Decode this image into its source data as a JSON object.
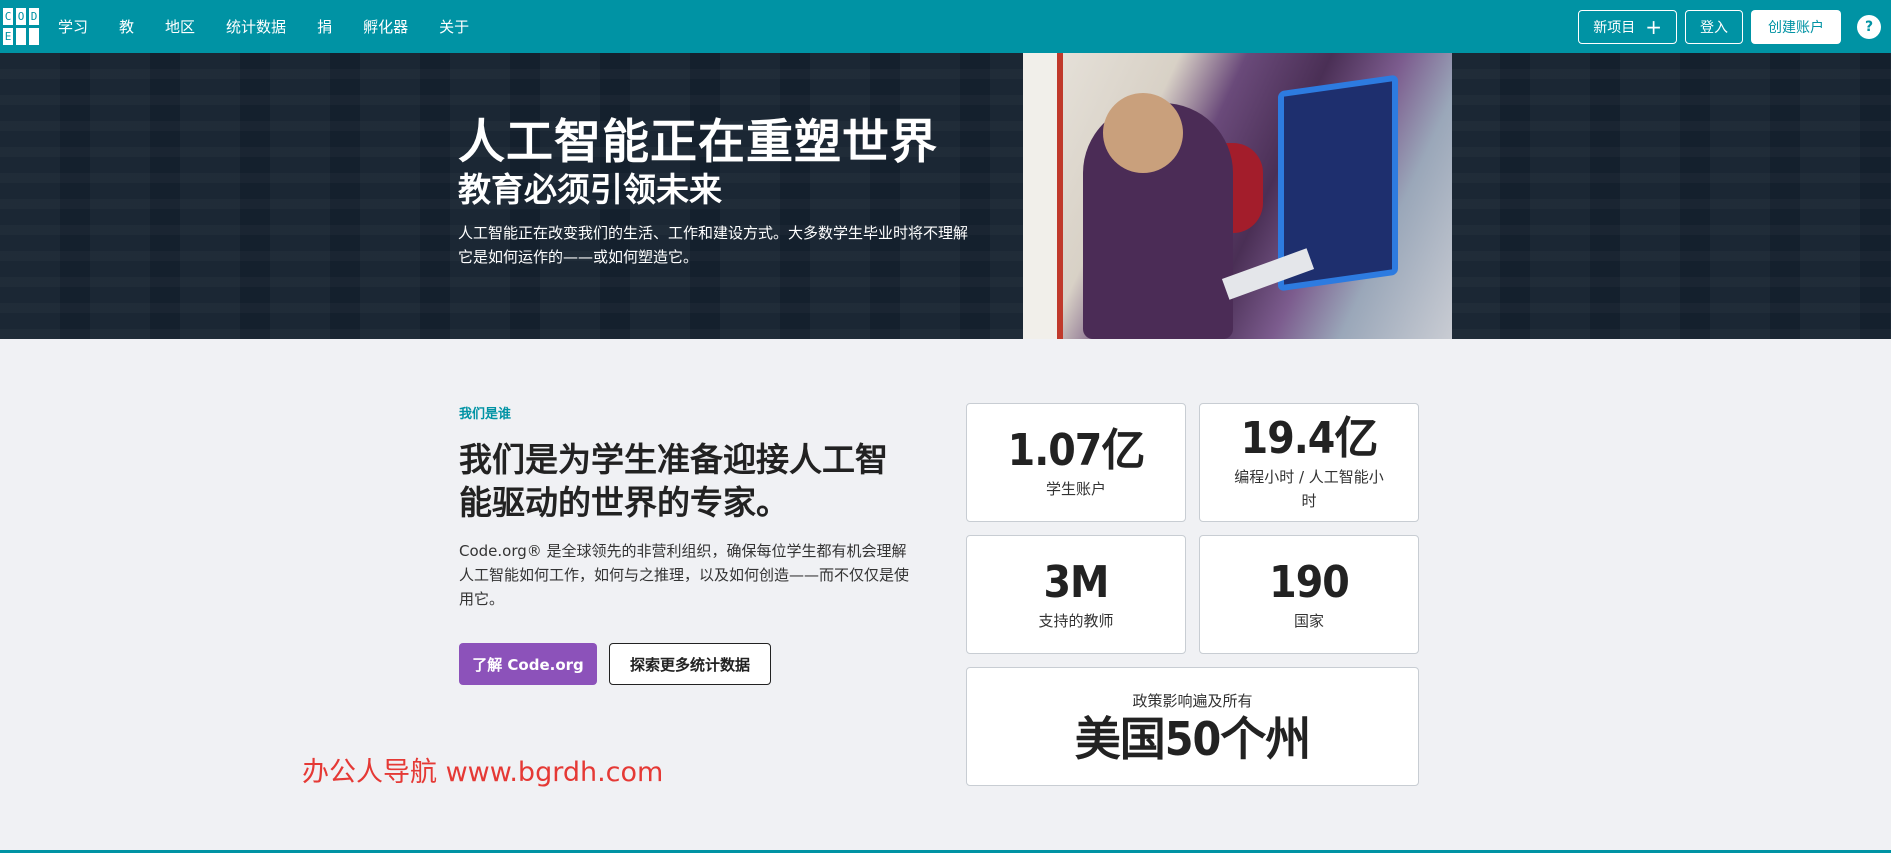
{
  "logo": {
    "letters": [
      "C",
      "O",
      "D",
      "E",
      "",
      ""
    ]
  },
  "nav": {
    "items": [
      "学习",
      "教",
      "地区",
      "统计数据",
      "捐",
      "孵化器",
      "关于"
    ],
    "new_project": "新项目",
    "sign_in": "登入",
    "create_account": "创建账户",
    "help": "?"
  },
  "hero": {
    "title": "人工智能正在重塑世界",
    "subtitle": "教育必须引领未来",
    "text": "人工智能正在改变我们的生活、工作和建设方式。大多数学生毕业时将不理解它是如何运作的——或如何塑造它。"
  },
  "who": {
    "eyebrow": "我们是谁",
    "title": "我们是为学生准备迎接人工智能驱动的世界的专家。",
    "text": "Code.org® 是全球领先的非营利组织，确保每位学生都有机会理解人工智能如何工作，如何与之推理，以及如何创造——而不仅仅是使用它。",
    "primary_button": "了解 Code.org",
    "secondary_button": "探索更多统计数据"
  },
  "stats": [
    {
      "number": "1.07亿",
      "label": "学生账户"
    },
    {
      "number": "19.4亿",
      "label": "编程小时 / 人工智能小时"
    },
    {
      "number": "3M",
      "label": "支持的教师"
    },
    {
      "number": "190",
      "label": "国家"
    }
  ],
  "policy": {
    "label": "政策影响遍及所有",
    "number": "美国50个州"
  },
  "watermark": "办公人导航  www.bgrdh.com",
  "colors": {
    "teal": "#0093a4",
    "purple": "#8c52ba",
    "hero_bg": "#14202d"
  }
}
